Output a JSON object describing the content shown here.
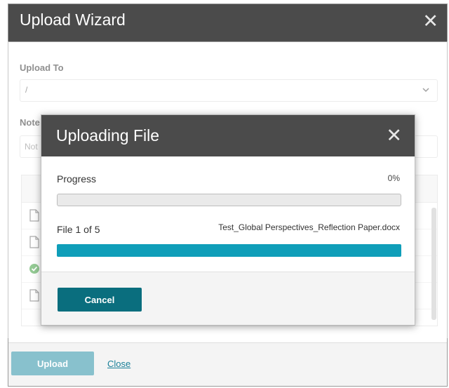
{
  "wizard": {
    "title": "Upload Wizard",
    "close_glyph": "✕",
    "upload_to_label": "Upload To",
    "upload_to_value": "/",
    "notes_label": "Note",
    "notes_placeholder": "Not",
    "upload_button": "Upload",
    "close_link": "Close"
  },
  "modal": {
    "title": "Uploading File",
    "close_glyph": "✕",
    "progress_label": "Progress",
    "progress_percent": "0%",
    "progress_value": 0,
    "file_count": "File 1 of 5",
    "file_name": "Test_Global Perspectives_Reflection Paper.docx",
    "file_progress_value": 100,
    "cancel_button": "Cancel"
  },
  "file_list": {
    "rows": [
      {
        "icon": "document-icon"
      },
      {
        "icon": "document-icon"
      },
      {
        "icon": "check-circle-icon"
      },
      {
        "icon": "document-icon"
      }
    ]
  },
  "colors": {
    "header_bg": "#4b4b4b",
    "accent": "#0f9eb9",
    "cancel_bg": "#0a6e7e",
    "upload_disabled_bg": "#88c1cd",
    "success_green": "#3c9e3c",
    "link": "#1a7f98"
  }
}
